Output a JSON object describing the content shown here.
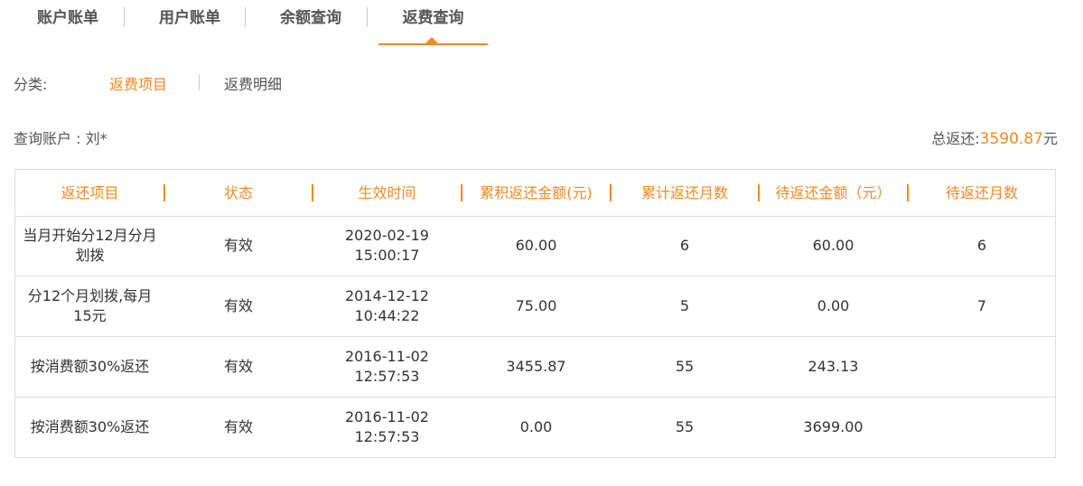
{
  "tabs": [
    "账户账单",
    "用户账单",
    "余额查询",
    "返费查询"
  ],
  "active_tab_index": 3,
  "accent_color": "#f08a24",
  "category": {
    "label": "分类:",
    "options": [
      "返费项目",
      "返费明细"
    ],
    "active_index": 0
  },
  "account": {
    "label": "查询账户 : 刘*",
    "total_label": "总返还:",
    "total_value": "3590.87",
    "total_unit": "元"
  },
  "table": {
    "headers": [
      "返还项目",
      "状态",
      "生效时间",
      "累积返还金额(元)",
      "累计返还月数",
      "待返还金额（元）",
      "待返还月数"
    ],
    "rows": [
      {
        "item_line1": "当月开始分12月分月",
        "item_line2": "划拨",
        "status": "有效",
        "date": "2020-02-19",
        "time": "15:00:17",
        "returned": "60.00",
        "months": "6",
        "pending": "60.00",
        "pending_months": "6"
      },
      {
        "item_line1": "分12个月划拨,每月",
        "item_line2": "15元",
        "status": "有效",
        "date": "2014-12-12",
        "time": "10:44:22",
        "returned": "75.00",
        "months": "5",
        "pending": "0.00",
        "pending_months": "7"
      },
      {
        "item_line1": "按消费额30%返还",
        "item_line2": "",
        "status": "有效",
        "date": "2016-11-02",
        "time": "12:57:53",
        "returned": "3455.87",
        "months": "55",
        "pending": "243.13",
        "pending_months": ""
      },
      {
        "item_line1": "按消费额30%返还",
        "item_line2": "",
        "status": "有效",
        "date": "2016-11-02",
        "time": "12:57:53",
        "returned": "0.00",
        "months": "55",
        "pending": "3699.00",
        "pending_months": ""
      }
    ]
  }
}
